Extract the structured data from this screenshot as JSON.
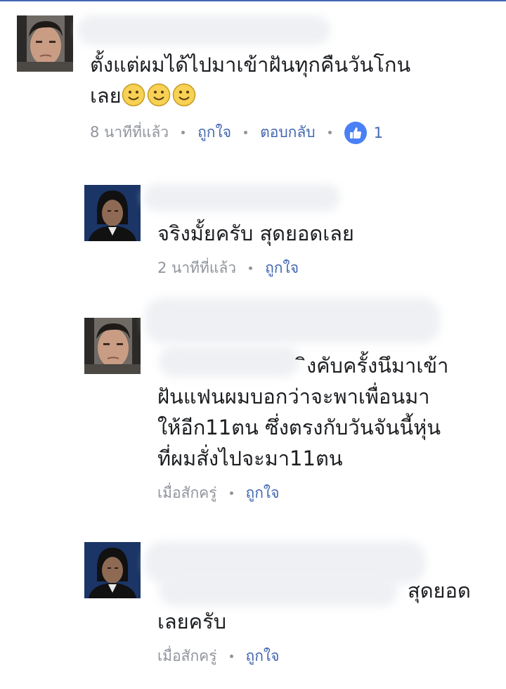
{
  "theme": {
    "accent": "#4267b2",
    "like_badge": "#4a80f5",
    "meta_gray": "#90949c",
    "text": "#1c1e21"
  },
  "comments": [
    {
      "lines": [
        "ตั้งแต่ผมได้ไปมาเข้าฝันทุกคืนวันโกน",
        "เลย"
      ],
      "emoji": [
        "slightly-smiling-face-icon",
        "slightly-smiling-face-icon",
        "slightly-smiling-face-icon"
      ],
      "time": "8 นาทีที่แล้ว",
      "like_label": "ถูกใจ",
      "reply_label": "ตอบกลับ",
      "like_count": "1"
    },
    {
      "lines": [
        "จริงมั้ยครับ สุดยอดเลย"
      ],
      "time": "2 นาทีที่แล้ว",
      "like_label": "ถูกใจ"
    },
    {
      "lines": [
        "ิงคับครั้งนึมาเข้า",
        "ฝันแฟนผมบอกว่าจะพาเพื่อนมา",
        "ให้อีก11ตน ซึ่งตรงกับวันจันนี้หุ่น",
        "ที่ผมสั่งไปจะมา11ตน"
      ],
      "time": "เมื่อสักครู่",
      "like_label": "ถูกใจ"
    },
    {
      "lines": [
        "สุดยอด",
        "เลยครับ"
      ],
      "time": "เมื่อสักครู่",
      "like_label": "ถูกใจ"
    }
  ]
}
